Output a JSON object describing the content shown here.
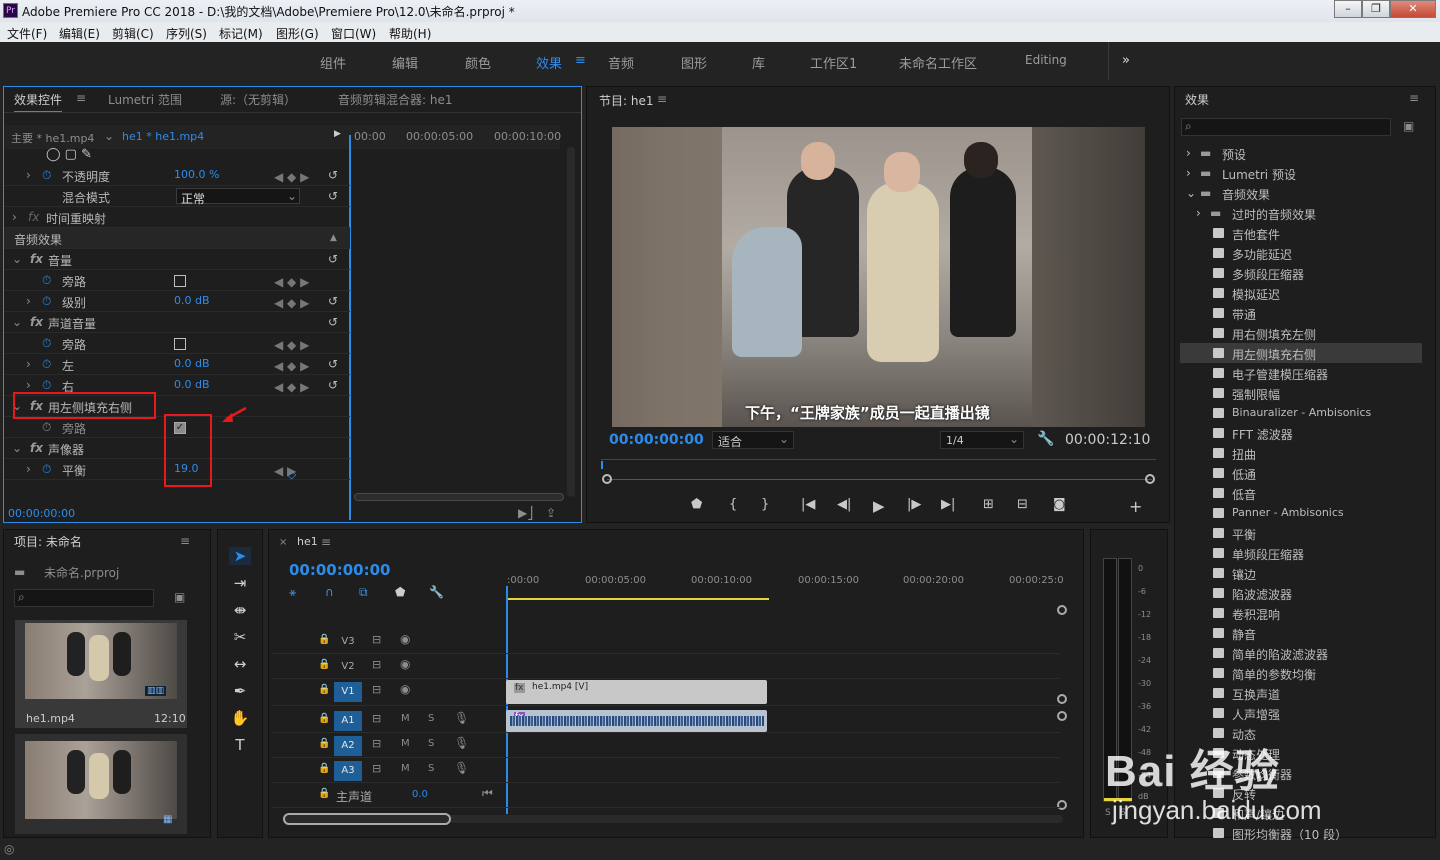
{
  "window": {
    "app_icon": "Pr",
    "title": "Adobe Premiere Pro CC 2018 - D:\\我的文档\\Adobe\\Premiere Pro\\12.0\\未命名.prproj *",
    "controls": [
      "–",
      "❐",
      "✕"
    ]
  },
  "menu": [
    "文件(F)",
    "编辑(E)",
    "剪辑(C)",
    "序列(S)",
    "标记(M)",
    "图形(G)",
    "窗口(W)",
    "帮助(H)"
  ],
  "workspaces": {
    "tabs": [
      "组件",
      "编辑",
      "颜色",
      "效果",
      "音频",
      "图形",
      "库",
      "工作区1",
      "未命名工作区",
      "Editing"
    ],
    "active": "效果",
    "overflow": "»"
  },
  "effect_controls": {
    "tabs": [
      "效果控件",
      "Lumetri 范围",
      "源:（无剪辑）",
      "音频剪辑混合器: he1"
    ],
    "master": "主要 * he1.mp4",
    "clip": "he1 * he1.mp4",
    "ruler": [
      "00:00",
      "00:00:05:00",
      "00:00:10:00"
    ],
    "rows": [
      {
        "label": "不透明度",
        "value": "100.0 %"
      },
      {
        "label": "混合模式",
        "value": "正常"
      },
      {
        "label": "时间重映射",
        "value": ""
      },
      {
        "label": "音频效果",
        "value": ""
      },
      {
        "label": "音量",
        "value": ""
      },
      {
        "label": "旁路",
        "value": ""
      },
      {
        "label": "级别",
        "value": "0.0 dB"
      },
      {
        "label": "声道音量",
        "value": ""
      },
      {
        "label": "旁路",
        "value": ""
      },
      {
        "label": "左",
        "value": "0.0 dB"
      },
      {
        "label": "右",
        "value": "0.0 dB"
      },
      {
        "label": "用左侧填充右侧",
        "value": ""
      },
      {
        "label": "旁路",
        "value": ""
      },
      {
        "label": "声像器",
        "value": ""
      },
      {
        "label": "平衡",
        "value": "19.0"
      }
    ],
    "fx": "fx",
    "timecode": "00:00:00:00"
  },
  "program": {
    "title": "节目: he1",
    "caption": "下午，“王牌家族”成员一起直播出镜",
    "timecode": "00:00:00:00",
    "fit": "适合",
    "quality": "1/4",
    "duration": "00:00:12:10"
  },
  "effects_panel": {
    "title": "效果",
    "folders": [
      "预设",
      "Lumetri 预设",
      "音频效果",
      "过时的音频效果"
    ],
    "items": [
      "吉他套件",
      "多功能延迟",
      "多频段压缩器",
      "模拟延迟",
      "带通",
      "用右侧填充左侧",
      "用左侧填充右侧",
      "电子管建模压缩器",
      "强制限幅",
      "Binauralizer - Ambisonics",
      "FFT 滤波器",
      "扭曲",
      "低通",
      "低音",
      "Panner - Ambisonics",
      "平衡",
      "单频段压缩器",
      "镶边",
      "陷波滤波器",
      "卷积混响",
      "静音",
      "简单的陷波滤波器",
      "简单的参数均衡",
      "互换声道",
      "人声增强",
      "动态",
      "动态处理",
      "参数均衡器",
      "反转",
      "和声/镶边",
      "图形均衡器（10 段）"
    ],
    "selected": "用左侧填充右侧"
  },
  "project": {
    "title": "项目: 未命名",
    "file": "未命名.prproj",
    "clip_name": "he1.mp4",
    "clip_duration": "12:10"
  },
  "timeline": {
    "tab": "he1",
    "timecode": "00:00:00:00",
    "ruler": [
      ":00:00",
      "00:00:05:00",
      "00:00:10:00",
      "00:00:15:00",
      "00:00:20:00",
      "00:00:25:0"
    ],
    "video_tracks": [
      "V3",
      "V2",
      "V1"
    ],
    "audio_tracks": [
      "A1",
      "A2",
      "A3"
    ],
    "master": "主声道",
    "master_value": "0.0",
    "clip_label": "he1.mp4 [V]",
    "m": "M",
    "s": "S"
  },
  "meter": {
    "scale": [
      "0",
      "-6",
      "-12",
      "-18",
      "-24",
      "-30",
      "-36",
      "-42",
      "-48",
      "-54",
      "dB"
    ],
    "s_labels": [
      "S",
      "S"
    ]
  },
  "watermark": {
    "logo": "Bai 经验",
    "url": "jingyan.baidu.com"
  }
}
